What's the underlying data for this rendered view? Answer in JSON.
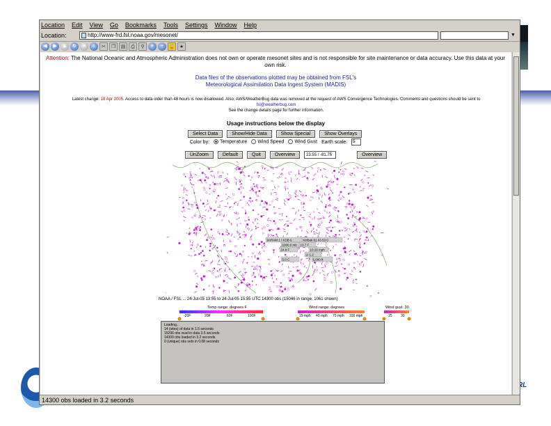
{
  "browser": {
    "menu": [
      "Location",
      "Edit",
      "View",
      "Go",
      "Bookmarks",
      "Tools",
      "Settings",
      "Window",
      "Help"
    ],
    "location_label": "Location:",
    "url": "http://www-frd.fsl.noaa.gov/mesonet/"
  },
  "page": {
    "attention_label": "Attention:",
    "attention_text": "The National Oceanic and Atmospheric Administration does not own or operate mesonet sites and is not responsible for site maintenance or data accuracy. Use this data at your own risk.",
    "data_files_line1": "Data files of the observations plotted may be obtained from FSL's",
    "data_files_line2": "Meteorological Assimilation Data Ingest System (MADIS)",
    "latest_prefix": "Latest change: ",
    "latest_date": "18 Apr 2005",
    "latest_text": ". Access to data older than 48 hours is now disallowed. Also, AWS/WeatherBug data was removed at the request of AWS Convergence Technologies. Comments and questions should be sent to",
    "latest_email": "fsl@weatherbug.com",
    "latest_see": "See the change details page for further information.",
    "usage_title": "Usage instructions below the display",
    "buttons_row1": [
      "Select Data",
      "Show/Hide Data",
      "Show Special",
      "Show Overlays"
    ],
    "color_by_label": "Color by:",
    "color_options": [
      "Temperature",
      "Wind Speed",
      "Wind Gust"
    ],
    "earth_radius_label": "Earth scale:",
    "earth_radius_value": "5",
    "buttons_row2": [
      "UnZoom",
      "Default",
      "Quit",
      "Overview"
    ],
    "coord_value": "23.55 / -81.75",
    "overview2": "Overview",
    "info_line": "NOAA / FSL  ... 24-Jul-05 13:55 to 24-Jul-05 15:55 UTC  14300 obs (15046 in range, 1061 shown)",
    "legend": {
      "temp_label": "Temp range: degrees F",
      "temp_ticks": [
        "-20F",
        "20F",
        "60F",
        "100F"
      ],
      "wind_label": "Wind range: degrees",
      "wind_ticks": [
        "15 mph",
        "40 mph",
        "70 mph",
        "100 mph"
      ],
      "gust_label": "Wind gust: 30",
      "gust_ticks": [
        "15",
        "30"
      ]
    },
    "log_lines": [
      "Loading...",
      "14 (sites) of data in 1.5 seconds",
      "15296 obs read in data 3.5 seconds",
      "14300 obs loaded in 3.2 seconds",
      "0 (unique) obs sets in 0.08 seconds"
    ],
    "map_labels": [
      "9ARAM 1 / KDB 6",
      "Kiribati 81 03 53 0",
      "1000.0 mb",
      "13.7 F",
      "10.20 mph",
      "24.9 F",
      "LI 1.2",
      "5.0 C",
      "5,000 ft"
    ]
  },
  "status": "14300 obs loaded in 3.2 seconds",
  "colors": {
    "station": "#c020c8",
    "link": "#1a24a8",
    "accent": "#d08b18",
    "map_bg": "#ffffff"
  }
}
